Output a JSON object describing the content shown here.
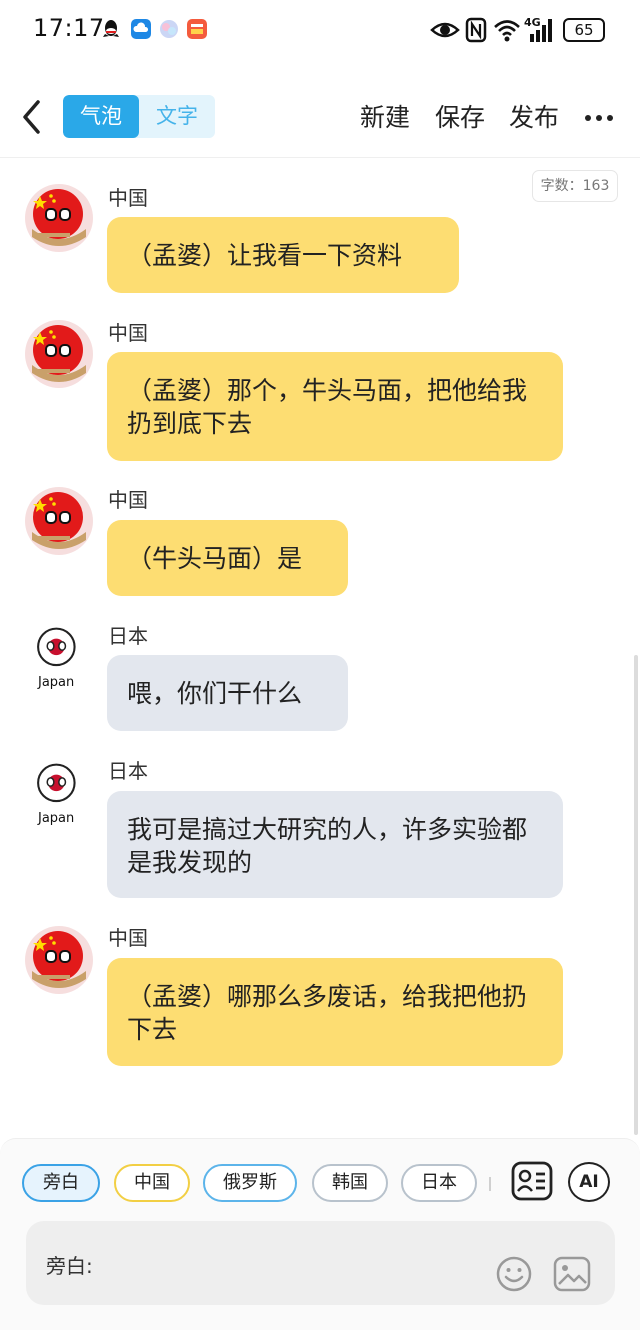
{
  "status_bar": {
    "time": "17:17",
    "network": "4G",
    "battery": "65",
    "icons": [
      "qq-icon",
      "cloud-icon",
      "circle-app-icon",
      "gallery-app-icon",
      "eye-icon",
      "nfc-icon",
      "wifi-icon",
      "signal-icon",
      "battery-icon"
    ]
  },
  "header": {
    "tabs": [
      {
        "label": "气泡",
        "active": true
      },
      {
        "label": "文字",
        "active": false
      }
    ],
    "actions": {
      "new": "新建",
      "save": "保存",
      "publish": "发布"
    },
    "word_count": "字数：163"
  },
  "colors": {
    "accent": "#2aa8e8",
    "china_bubble": "#fddd72",
    "japan_bubble": "#e3e7ee",
    "china_red": "#e21a1a",
    "japan_red": "#c8102e"
  },
  "messages": [
    {
      "sender": "中国",
      "avatar": "china-countryball",
      "text": "（孟婆）让我看一下资料"
    },
    {
      "sender": "中国",
      "avatar": "china-countryball",
      "text": "（孟婆）那个，牛头马面，把他给我扔到底下去"
    },
    {
      "sender": "中国",
      "avatar": "china-countryball",
      "text": "（牛头马面）是"
    },
    {
      "sender": "日本",
      "avatar": "japan-countryball",
      "avatar_caption": "Japan",
      "text": "喂，你们干什么"
    },
    {
      "sender": "日本",
      "avatar": "japan-countryball",
      "avatar_caption": "Japan",
      "text": "我可是搞过大研究的人，许多实验都是我发现的"
    },
    {
      "sender": "中国",
      "avatar": "china-countryball",
      "text": "（孟婆）哪那么多废话，给我把他扔下去"
    }
  ],
  "bottom": {
    "roles": [
      "旁白",
      "中国",
      "俄罗斯",
      "韩国",
      "日本"
    ],
    "selected_role": "旁白",
    "ai_label": "AI",
    "input_label": "旁白:"
  }
}
